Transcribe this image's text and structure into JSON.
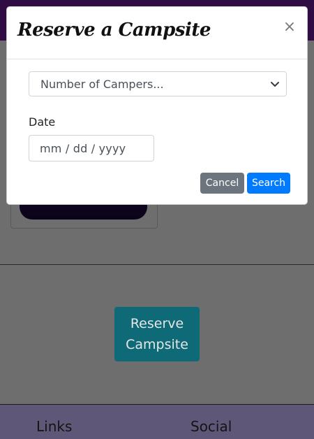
{
  "modal": {
    "title": "Reserve a Campsite",
    "close_label": "×",
    "campers_select": {
      "selected": "Number of Campers..."
    },
    "date_label": "Date",
    "date_input": {
      "placeholder": "mm / dd / yyyy"
    },
    "cancel_label": "Cancel",
    "search_label": "Search"
  },
  "page": {
    "reserve_button_label": "Reserve Campsite"
  },
  "footer": {
    "links_heading": "Links",
    "social_heading": "Social"
  },
  "colors": {
    "nav_bg": "#2f0c44",
    "reserve_button": "#17a2b8",
    "cancel_button": "#6c757d",
    "search_button": "#007bff",
    "footer_bg": "#5f5778"
  }
}
